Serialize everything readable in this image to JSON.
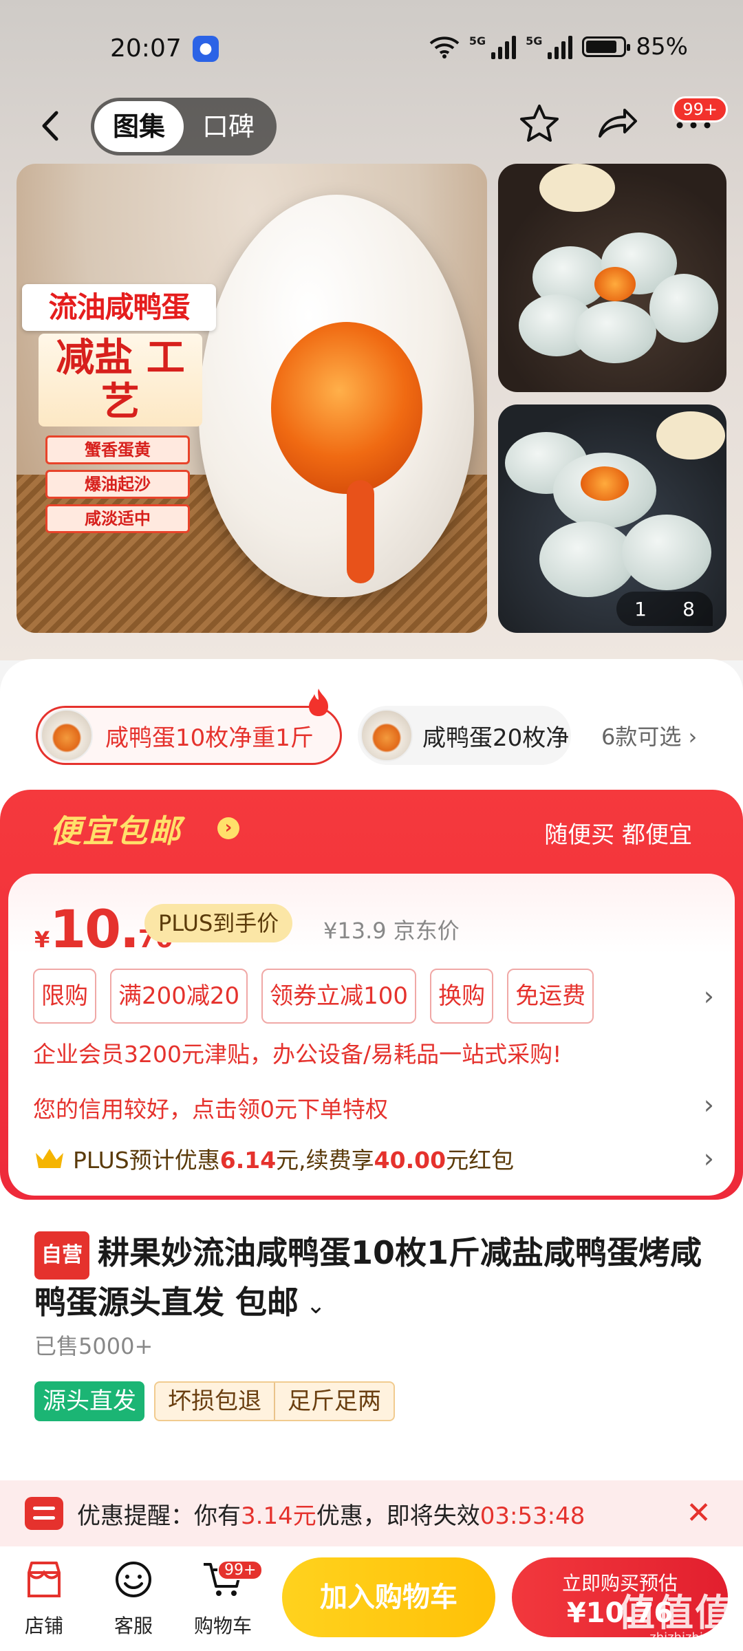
{
  "status_bar": {
    "time": "20:07",
    "app_icon": "baidu-paw-icon",
    "network_1": "5G",
    "network_2": "5G",
    "battery_percent": "85%",
    "battery_level": 0.85
  },
  "nav": {
    "tabs": [
      "图集",
      "口碑"
    ],
    "active_tab": "图集",
    "icons": [
      "back-icon",
      "star-icon",
      "share-icon",
      "more-icon"
    ],
    "more_badge": "99+"
  },
  "gallery": {
    "main_image": {
      "title": "流油咸鸭蛋",
      "subtitle": "减盐 工艺",
      "tags": [
        "蟹香蛋黄",
        "爆油起沙",
        "咸淡适中"
      ]
    },
    "counter_current": "1",
    "counter_total": "8"
  },
  "variants": {
    "items": [
      "咸鸭蛋10枚净重1斤",
      "咸鸭蛋20枚净"
    ],
    "selected": "咸鸭蛋10枚净重1斤",
    "more": "6款可选"
  },
  "promo": {
    "header": "便宜包邮",
    "header_right": "随便买 都便宜",
    "price_currency": "¥",
    "price_integer": "10.",
    "price_decimal": "76",
    "plus_tag": "PLUS到手价",
    "jd_price": "¥13.9 京东价",
    "tags": [
      "限购",
      "满200减20",
      "领券立减100",
      "换购",
      "免运费"
    ],
    "enterprise_line": "企业会员3200元津贴，办公设备/易耗品一站式采购!",
    "credit_line": "您的信用较好，点击领0元下单特权",
    "plus_line_prefix": "PLUS预计优惠",
    "plus_line_amount1": "6.14",
    "plus_line_mid": "元,续费享",
    "plus_line_amount2": "40.00",
    "plus_line_suffix": "元红包"
  },
  "product": {
    "self_operated_tag": "自营",
    "title": "耕果妙流油咸鸭蛋10枚1斤减盐咸鸭蛋烤咸鸭蛋源头直发 包邮",
    "sold": "已售5000+",
    "feature_green": "源头直发",
    "features": [
      "坏损包退",
      "足斤足两"
    ]
  },
  "reminder": {
    "prefix": "优惠提醒：你有",
    "amount": "3.14元",
    "middle": "优惠，即将失效",
    "countdown": "03:53:48"
  },
  "bottom_bar": {
    "items": [
      {
        "label": "店铺",
        "icon": "store-icon"
      },
      {
        "label": "客服",
        "icon": "customer-service-icon"
      },
      {
        "label": "购物车",
        "icon": "cart-icon"
      }
    ],
    "cart_badge": "99+",
    "add_to_cart": "加入购物车",
    "buy_now_line1": "立即购买预估",
    "buy_now_line2": "¥10.76"
  },
  "watermark": {
    "main": "值值值",
    "sub": "zhizhizhi.com"
  },
  "colors": {
    "accent_red": "#e5322d",
    "cart_yellow": "#ffc107",
    "plus_gold": "#fbe6a6",
    "green_tag": "#1bb574"
  }
}
